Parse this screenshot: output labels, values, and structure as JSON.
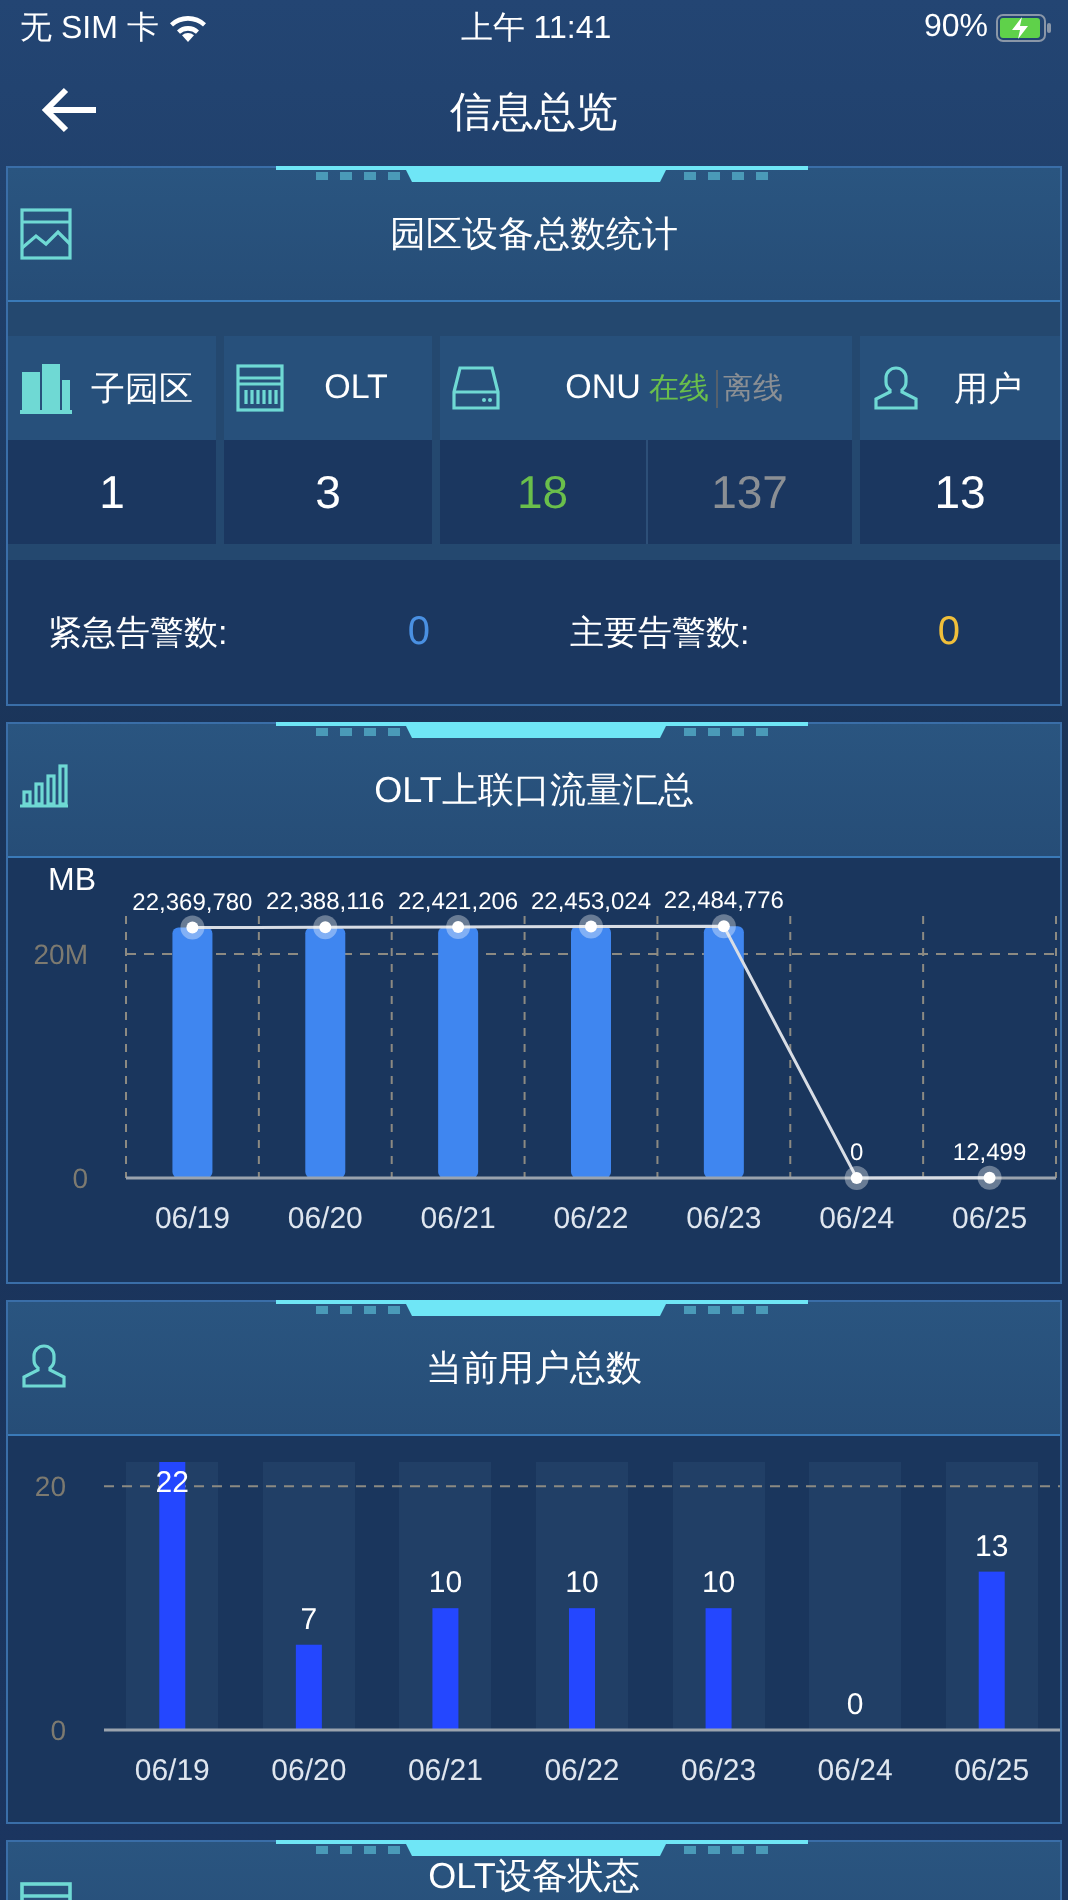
{
  "status_bar": {
    "carrier": "无 SIM 卡",
    "time": "上午 11:41",
    "battery": "90%"
  },
  "nav": {
    "title": "信息总览"
  },
  "device_stats": {
    "title": "园区设备总数统计",
    "columns": [
      {
        "kind": "single",
        "label": "子园区",
        "value": "1"
      },
      {
        "kind": "single",
        "label": "OLT",
        "value": "3"
      },
      {
        "kind": "split",
        "label": "ONU",
        "online_label": "在线",
        "offline_label": "离线",
        "online_value": "18",
        "offline_value": "137"
      },
      {
        "kind": "single",
        "label": "用户",
        "value": "13"
      }
    ],
    "alarms": [
      {
        "label": "紧急告警数:",
        "value": "0",
        "color": "#4a90e2"
      },
      {
        "label": "主要告警数:",
        "value": "0",
        "color": "#f0bf3a"
      }
    ]
  },
  "traffic": {
    "title": "OLT上联口流量汇总",
    "chart_data": {
      "type": "bar",
      "ylabel": "MB",
      "categories": [
        "06/19",
        "06/20",
        "06/21",
        "06/22",
        "06/23",
        "06/24",
        "06/25"
      ],
      "series": [
        {
          "color": "#3f86f0",
          "values": [
            22369780,
            22388116,
            22421206,
            22453024,
            22484776,
            0,
            12499
          ]
        }
      ],
      "ylim": [
        0,
        23400000
      ],
      "yticks": [
        0,
        {
          "value": 20000000,
          "label": "20M"
        }
      ],
      "value_labels": [
        "22,369,780",
        "22,388,116",
        "22,421,206",
        "22,453,024",
        "22,484,776",
        "0",
        "12,499"
      ]
    }
  },
  "users": {
    "title": "当前用户总数",
    "chart_data": {
      "type": "bar",
      "categories": [
        "06/19",
        "06/20",
        "06/21",
        "06/22",
        "06/23",
        "06/24",
        "06/25"
      ],
      "series": [
        {
          "color": "#2447ff",
          "values": [
            22,
            7,
            10,
            10,
            10,
            0,
            13
          ]
        }
      ],
      "ylim": [
        0,
        22
      ],
      "yticks": [
        0,
        20
      ],
      "data_labels": true
    }
  },
  "olt_status": {
    "title": "OLT设备状态"
  }
}
